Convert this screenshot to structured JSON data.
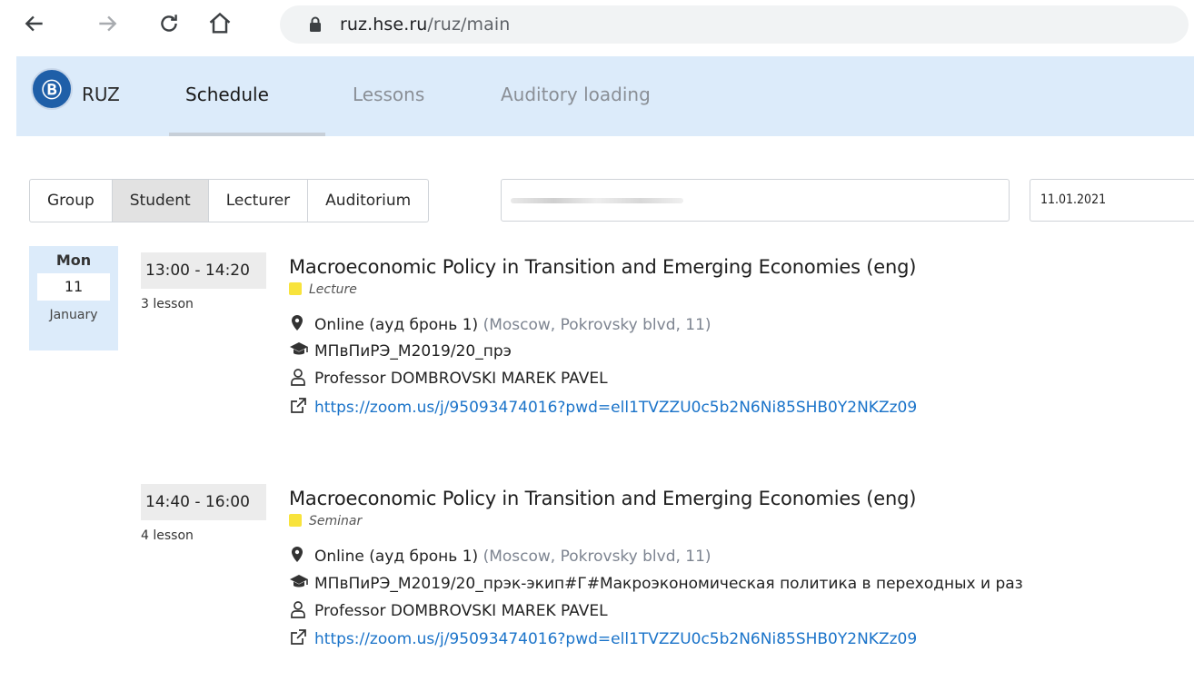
{
  "browser": {
    "url_host": "ruz.hse.ru",
    "url_path": "/ruz/main"
  },
  "header": {
    "logo_letter": "Ⓑ",
    "brand": "RUZ",
    "tabs": [
      {
        "label": "Schedule",
        "active": true
      },
      {
        "label": "Lessons",
        "active": false
      },
      {
        "label": "Auditory loading",
        "active": false
      }
    ]
  },
  "search": {
    "types": [
      {
        "label": "Group",
        "selected": false
      },
      {
        "label": "Student",
        "selected": true
      },
      {
        "label": "Lecturer",
        "selected": false
      },
      {
        "label": "Auditorium",
        "selected": false
      }
    ],
    "query": "",
    "date": "11.01.2021"
  },
  "day": {
    "weekday": "Mon",
    "number": "11",
    "month": "January"
  },
  "lessons": [
    {
      "time": "13:00 - 14:20",
      "lesson_num": "3 lesson",
      "title": "Macroeconomic Policy in Transition and Emerging Economies (eng)",
      "kind": "Lecture",
      "location": "Online (ауд бронь 1)",
      "address": "(Moscow, Pokrovsky blvd, 11)",
      "group": "МПвПиРЭ_М2019/20_прэ",
      "lecturer": "Professor DOMBROVSKI MAREK PAVEL",
      "link": "https://zoom.us/j/95093474016?pwd=ell1TVZZU0c5b2N6Ni85SHB0Y2NKZz09"
    },
    {
      "time": "14:40 - 16:00",
      "lesson_num": "4 lesson",
      "title": "Macroeconomic Policy in Transition and Emerging Economies (eng)",
      "kind": "Seminar",
      "location": "Online (ауд бронь 1)",
      "address": "(Moscow, Pokrovsky blvd, 11)",
      "group": "МПвПиРЭ_М2019/20_прэк-экип#Г#Макроэкономическая политика в переходных и раз",
      "lecturer": "Professor DOMBROVSKI MAREK PAVEL",
      "link": "https://zoom.us/j/95093474016?pwd=ell1TVZZU0c5b2N6Ni85SHB0Y2NKZz09"
    }
  ],
  "colors": {
    "header_bg": "#dcebfa",
    "link": "#1a73c9",
    "kind_swatch": "#f8e33c"
  },
  "icons": [
    "back-arrow-icon",
    "forward-arrow-icon",
    "reload-icon",
    "home-icon",
    "lock-icon",
    "location-pin-icon",
    "graduation-cap-icon",
    "person-icon",
    "external-link-icon"
  ]
}
